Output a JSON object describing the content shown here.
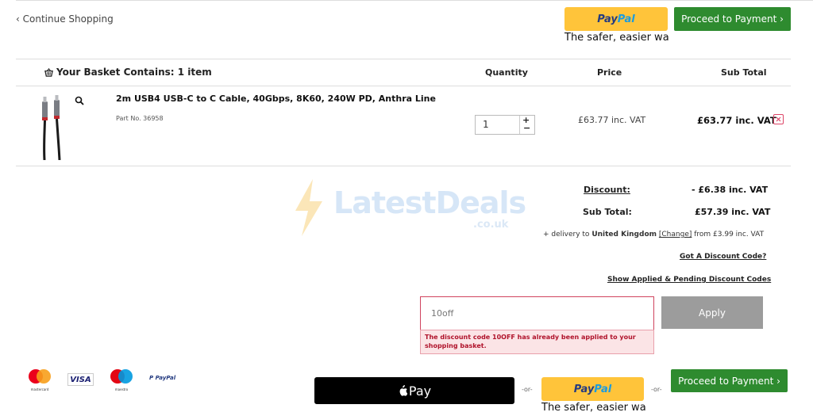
{
  "nav": {
    "continue_label": "‹ Continue Shopping"
  },
  "paypal": {
    "pay": "Pay",
    "pal": "Pal",
    "tagline": "The safer, easier wa"
  },
  "checkout": {
    "proceed_label": "Proceed to Payment ›"
  },
  "basket": {
    "title": "Your Basket Contains: 1 item",
    "columns": {
      "quantity": "Quantity",
      "price": "Price",
      "subtotal": "Sub Total"
    },
    "items": [
      {
        "name": "2m USB4 USB-C to C Cable, 40Gbps, 8K60, 240W PD, Anthra Line",
        "part_no": "Part No. 36958",
        "quantity": "1",
        "price": "£63.77 inc. VAT",
        "subtotal": "£63.77 inc. VAT"
      }
    ]
  },
  "summary": {
    "discount_label": "Discount:",
    "discount_value": "- £6.38 inc. VAT",
    "subtotal_label": "Sub Total:",
    "subtotal_value": "£57.39 inc. VAT",
    "delivery_prefix": "+ delivery to ",
    "delivery_country": "United Kingdom",
    "delivery_change": "[Change]",
    "delivery_suffix": " from £3.99 inc. VAT",
    "got_code_link": "Got A Discount Code?",
    "show_codes_link": "Show Applied & Pending Discount Codes"
  },
  "discount_form": {
    "input_value": "10off",
    "apply_label": "Apply",
    "error": "The discount code 10OFF has already been applied to your shopping basket."
  },
  "payment_logos": {
    "mastercard": "mastercard",
    "visa": "VISA",
    "maestro": "maestro",
    "paypal": "PayPal"
  },
  "bottom": {
    "applepay_label": "Pay",
    "or": "-or-"
  },
  "watermark": {
    "text": "LatestDeals",
    "sub": ".co.uk"
  }
}
